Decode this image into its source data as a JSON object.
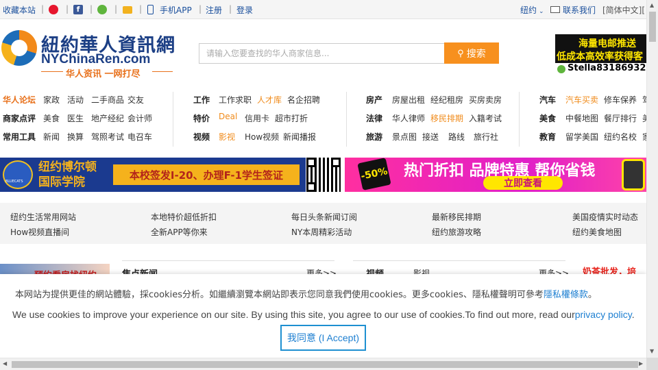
{
  "topbar": {
    "bookmark": "收藏本站",
    "sep": "|",
    "mobile_app": "手机APP",
    "register": "注册",
    "login": "登录",
    "region": "纽约",
    "contact": "联系我们",
    "lang": "[简体中文][",
    "icons": [
      "weibo-icon",
      "facebook-icon",
      "wechat-icon",
      "mail-icon",
      "phone-icon"
    ]
  },
  "header": {
    "logo_cn": "紐約華人資訊網",
    "logo_en": "NYChinaRen.com",
    "logo_slogan": "华人资讯 一网打尽",
    "search_placeholder": "请输入您要查找的华人商家信息...",
    "search_button": "搜索",
    "ad": {
      "line1": "海量电邮推送",
      "line2": "低成本高效率获得客",
      "line3": "Stella8318693286"
    }
  },
  "nav": {
    "col1": {
      "rows": [
        {
          "cat": "华人论坛",
          "items": [
            "家政",
            "活动",
            "二手商品",
            "交友"
          ]
        },
        {
          "cat": "商家点评",
          "items": [
            "美食",
            "医生",
            "地产经纪",
            "会计师"
          ]
        },
        {
          "cat": "常用工具",
          "items": [
            "新闻",
            "换算",
            "驾照考试",
            "电召车"
          ]
        }
      ]
    },
    "col2": {
      "rows": [
        {
          "cat": "工作",
          "items": [
            "工作求职",
            "人才库",
            "名企招聘"
          ]
        },
        {
          "cat": "特价",
          "items": [
            "Deal",
            "信用卡",
            "超市打折"
          ]
        },
        {
          "cat": "视频",
          "items": [
            "影视",
            "How视频",
            "新闻播报"
          ]
        }
      ]
    },
    "col3": {
      "rows": [
        {
          "cat": "房产",
          "items": [
            "房屋出租",
            "经纪租房",
            "买房卖房"
          ]
        },
        {
          "cat": "法律",
          "items": [
            "华人律师",
            "移民排期",
            "入籍考试"
          ]
        },
        {
          "cat": "旅游",
          "items": [
            "景点图",
            "接送",
            "路线",
            "旅行社"
          ]
        }
      ]
    },
    "col4": {
      "rows": [
        {
          "cat": "汽车",
          "items": [
            "汽车买卖",
            "修车保养",
            "驾"
          ]
        },
        {
          "cat": "美食",
          "items": [
            "中餐地图",
            "餐厅排行",
            "美"
          ]
        },
        {
          "cat": "教育",
          "items": [
            "留学美国",
            "纽约名校",
            "家"
          ]
        }
      ]
    },
    "highlight_color": "#f08b1b"
  },
  "banners": {
    "left_name_1": "纽约博尔顿",
    "left_name_2": "国际学院",
    "left_slogan": "本校签发I-20、办理F-1学生签证",
    "left_emblem": "BLUECATS",
    "right_badge": "-50%",
    "right_title": "热门折扣 品牌特惠 帮你省钱",
    "right_cta": "立即查看"
  },
  "quick_links": [
    [
      "纽约生活常用网站",
      "How视频直播间"
    ],
    [
      "本地特价超低折扣",
      "全新APP等你来"
    ],
    [
      "每日头条新闻订阅",
      "NY本周精彩活动"
    ],
    [
      "最新移民排期",
      "纽约旅游攻略"
    ],
    [
      "美国疫情实时动态",
      "纽约美食地图"
    ]
  ],
  "content": {
    "teaser_text": "预约看房找纽约",
    "focus_title": "焦点新闻",
    "more": "更多>>",
    "video_title": "视频",
    "video_tab": "影视",
    "promo": "奶茶批发，培"
  },
  "cookie": {
    "cn_text": "本网站为提供更佳的網站體驗，採cookies分析。如繼續瀏覽本網站即表示您同意我們使用cookies。更多cookies、隱私權聲明可參考",
    "cn_link": "隱私權條款",
    "cn_end": "。",
    "en_text": "We use cookies to improve your experience on our site. By using this site, you agree to our use of cookies.To find out more, read our",
    "en_link": "privacy policy",
    "en_end": ".",
    "button": "我同意 (I Accept)",
    "link_color": "#1d7fd1"
  }
}
